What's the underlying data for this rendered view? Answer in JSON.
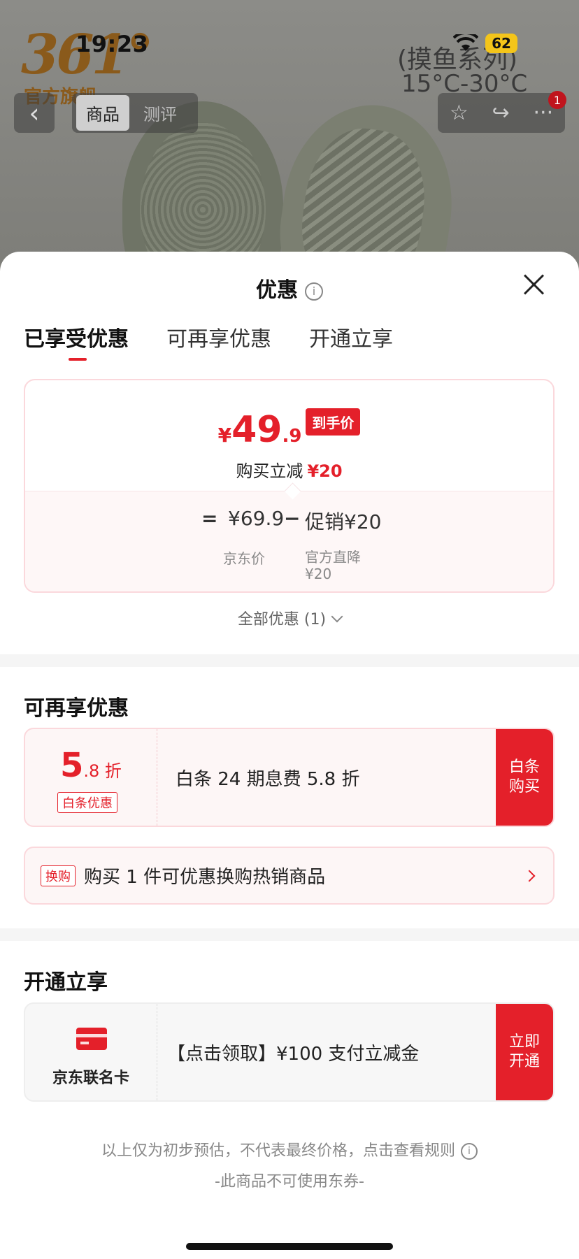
{
  "status_bar": {
    "time": "19:23",
    "battery": "62"
  },
  "background": {
    "brand_logo": "361°",
    "brand_store": "官方旗舰",
    "product_line": "(摸鱼系列)",
    "temperature": "15°C-30°C"
  },
  "nav": {
    "back_icon": "‹",
    "tabs": [
      {
        "label": "商品"
      },
      {
        "label": "测评"
      }
    ],
    "actions": {
      "favorite_icon": "☆",
      "share_icon": "↪",
      "more_icon": "···",
      "badge": "1"
    }
  },
  "sheet": {
    "title": "优惠",
    "tabs": [
      {
        "label": "已享受优惠"
      },
      {
        "label": "可再享优惠"
      },
      {
        "label": "开通立享"
      }
    ],
    "price_card": {
      "currency": "¥",
      "final_int": "49",
      "final_dec": ".9",
      "final_badge": "到手价",
      "sub_label": "购买立减",
      "sub_amount": "¥20",
      "eq": "=",
      "jd_price": "¥69.9",
      "jd_label": "京东价",
      "minus": "−",
      "promo": "促销¥20",
      "promo_label_1": "官方直降",
      "promo_label_2": "¥20"
    },
    "all_promo": "全部优惠 (1)",
    "more_section": {
      "title": "可再享优惠",
      "baitiao": {
        "rate_int": "5",
        "rate_dec": ".8 折",
        "tag": "白条优惠",
        "desc": "白条 24 期息费 5.8 折",
        "button_1": "白条",
        "button_2": "购买"
      },
      "swap": {
        "tag": "换购",
        "text": "购买 1 件可优惠换购热销商品"
      }
    },
    "open_section": {
      "title": "开通立享",
      "card": {
        "name": "京东联名卡",
        "desc": "【点击领取】¥100 支付立减金",
        "button_1": "立即",
        "button_2": "开通"
      }
    },
    "footnote": "以上仅为初步预估，不代表最终价格，点击查看规则",
    "footnote2": "-此商品不可使用东券-"
  },
  "colors": {
    "accent": "#e4202a",
    "card_border": "#fbd8dc",
    "card_bg": "#fdf6f6"
  }
}
